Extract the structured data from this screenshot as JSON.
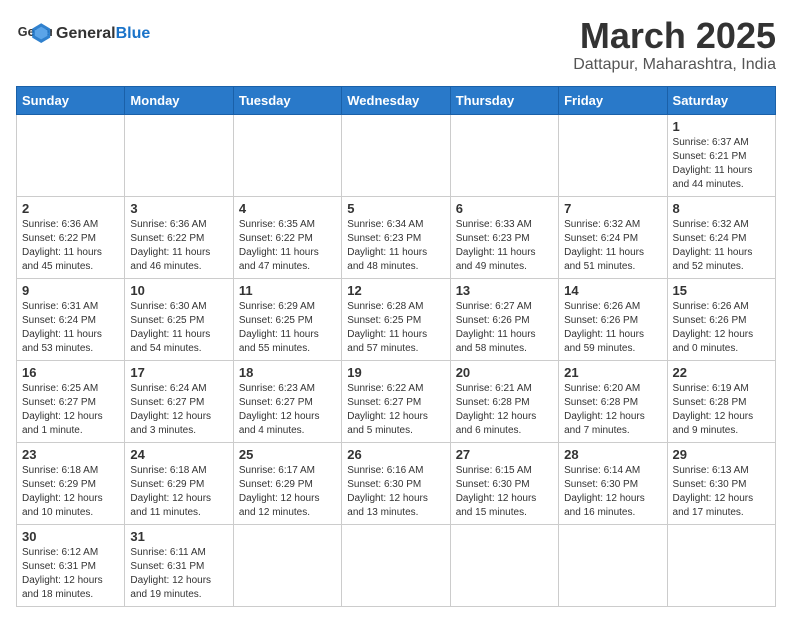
{
  "logo": {
    "text_general": "General",
    "text_blue": "Blue"
  },
  "title": {
    "month_year": "March 2025",
    "location": "Dattapur, Maharashtra, India"
  },
  "days_of_week": [
    "Sunday",
    "Monday",
    "Tuesday",
    "Wednesday",
    "Thursday",
    "Friday",
    "Saturday"
  ],
  "weeks": [
    [
      {
        "day": "",
        "info": ""
      },
      {
        "day": "",
        "info": ""
      },
      {
        "day": "",
        "info": ""
      },
      {
        "day": "",
        "info": ""
      },
      {
        "day": "",
        "info": ""
      },
      {
        "day": "",
        "info": ""
      },
      {
        "day": "1",
        "info": "Sunrise: 6:37 AM\nSunset: 6:21 PM\nDaylight: 11 hours\nand 44 minutes."
      }
    ],
    [
      {
        "day": "2",
        "info": "Sunrise: 6:36 AM\nSunset: 6:22 PM\nDaylight: 11 hours\nand 45 minutes."
      },
      {
        "day": "3",
        "info": "Sunrise: 6:36 AM\nSunset: 6:22 PM\nDaylight: 11 hours\nand 46 minutes."
      },
      {
        "day": "4",
        "info": "Sunrise: 6:35 AM\nSunset: 6:22 PM\nDaylight: 11 hours\nand 47 minutes."
      },
      {
        "day": "5",
        "info": "Sunrise: 6:34 AM\nSunset: 6:23 PM\nDaylight: 11 hours\nand 48 minutes."
      },
      {
        "day": "6",
        "info": "Sunrise: 6:33 AM\nSunset: 6:23 PM\nDaylight: 11 hours\nand 49 minutes."
      },
      {
        "day": "7",
        "info": "Sunrise: 6:32 AM\nSunset: 6:24 PM\nDaylight: 11 hours\nand 51 minutes."
      },
      {
        "day": "8",
        "info": "Sunrise: 6:32 AM\nSunset: 6:24 PM\nDaylight: 11 hours\nand 52 minutes."
      }
    ],
    [
      {
        "day": "9",
        "info": "Sunrise: 6:31 AM\nSunset: 6:24 PM\nDaylight: 11 hours\nand 53 minutes."
      },
      {
        "day": "10",
        "info": "Sunrise: 6:30 AM\nSunset: 6:25 PM\nDaylight: 11 hours\nand 54 minutes."
      },
      {
        "day": "11",
        "info": "Sunrise: 6:29 AM\nSunset: 6:25 PM\nDaylight: 11 hours\nand 55 minutes."
      },
      {
        "day": "12",
        "info": "Sunrise: 6:28 AM\nSunset: 6:25 PM\nDaylight: 11 hours\nand 57 minutes."
      },
      {
        "day": "13",
        "info": "Sunrise: 6:27 AM\nSunset: 6:26 PM\nDaylight: 11 hours\nand 58 minutes."
      },
      {
        "day": "14",
        "info": "Sunrise: 6:26 AM\nSunset: 6:26 PM\nDaylight: 11 hours\nand 59 minutes."
      },
      {
        "day": "15",
        "info": "Sunrise: 6:26 AM\nSunset: 6:26 PM\nDaylight: 12 hours\nand 0 minutes."
      }
    ],
    [
      {
        "day": "16",
        "info": "Sunrise: 6:25 AM\nSunset: 6:27 PM\nDaylight: 12 hours\nand 1 minute."
      },
      {
        "day": "17",
        "info": "Sunrise: 6:24 AM\nSunset: 6:27 PM\nDaylight: 12 hours\nand 3 minutes."
      },
      {
        "day": "18",
        "info": "Sunrise: 6:23 AM\nSunset: 6:27 PM\nDaylight: 12 hours\nand 4 minutes."
      },
      {
        "day": "19",
        "info": "Sunrise: 6:22 AM\nSunset: 6:27 PM\nDaylight: 12 hours\nand 5 minutes."
      },
      {
        "day": "20",
        "info": "Sunrise: 6:21 AM\nSunset: 6:28 PM\nDaylight: 12 hours\nand 6 minutes."
      },
      {
        "day": "21",
        "info": "Sunrise: 6:20 AM\nSunset: 6:28 PM\nDaylight: 12 hours\nand 7 minutes."
      },
      {
        "day": "22",
        "info": "Sunrise: 6:19 AM\nSunset: 6:28 PM\nDaylight: 12 hours\nand 9 minutes."
      }
    ],
    [
      {
        "day": "23",
        "info": "Sunrise: 6:18 AM\nSunset: 6:29 PM\nDaylight: 12 hours\nand 10 minutes."
      },
      {
        "day": "24",
        "info": "Sunrise: 6:18 AM\nSunset: 6:29 PM\nDaylight: 12 hours\nand 11 minutes."
      },
      {
        "day": "25",
        "info": "Sunrise: 6:17 AM\nSunset: 6:29 PM\nDaylight: 12 hours\nand 12 minutes."
      },
      {
        "day": "26",
        "info": "Sunrise: 6:16 AM\nSunset: 6:30 PM\nDaylight: 12 hours\nand 13 minutes."
      },
      {
        "day": "27",
        "info": "Sunrise: 6:15 AM\nSunset: 6:30 PM\nDaylight: 12 hours\nand 15 minutes."
      },
      {
        "day": "28",
        "info": "Sunrise: 6:14 AM\nSunset: 6:30 PM\nDaylight: 12 hours\nand 16 minutes."
      },
      {
        "day": "29",
        "info": "Sunrise: 6:13 AM\nSunset: 6:30 PM\nDaylight: 12 hours\nand 17 minutes."
      }
    ],
    [
      {
        "day": "30",
        "info": "Sunrise: 6:12 AM\nSunset: 6:31 PM\nDaylight: 12 hours\nand 18 minutes."
      },
      {
        "day": "31",
        "info": "Sunrise: 6:11 AM\nSunset: 6:31 PM\nDaylight: 12 hours\nand 19 minutes."
      },
      {
        "day": "",
        "info": ""
      },
      {
        "day": "",
        "info": ""
      },
      {
        "day": "",
        "info": ""
      },
      {
        "day": "",
        "info": ""
      },
      {
        "day": "",
        "info": ""
      }
    ]
  ]
}
